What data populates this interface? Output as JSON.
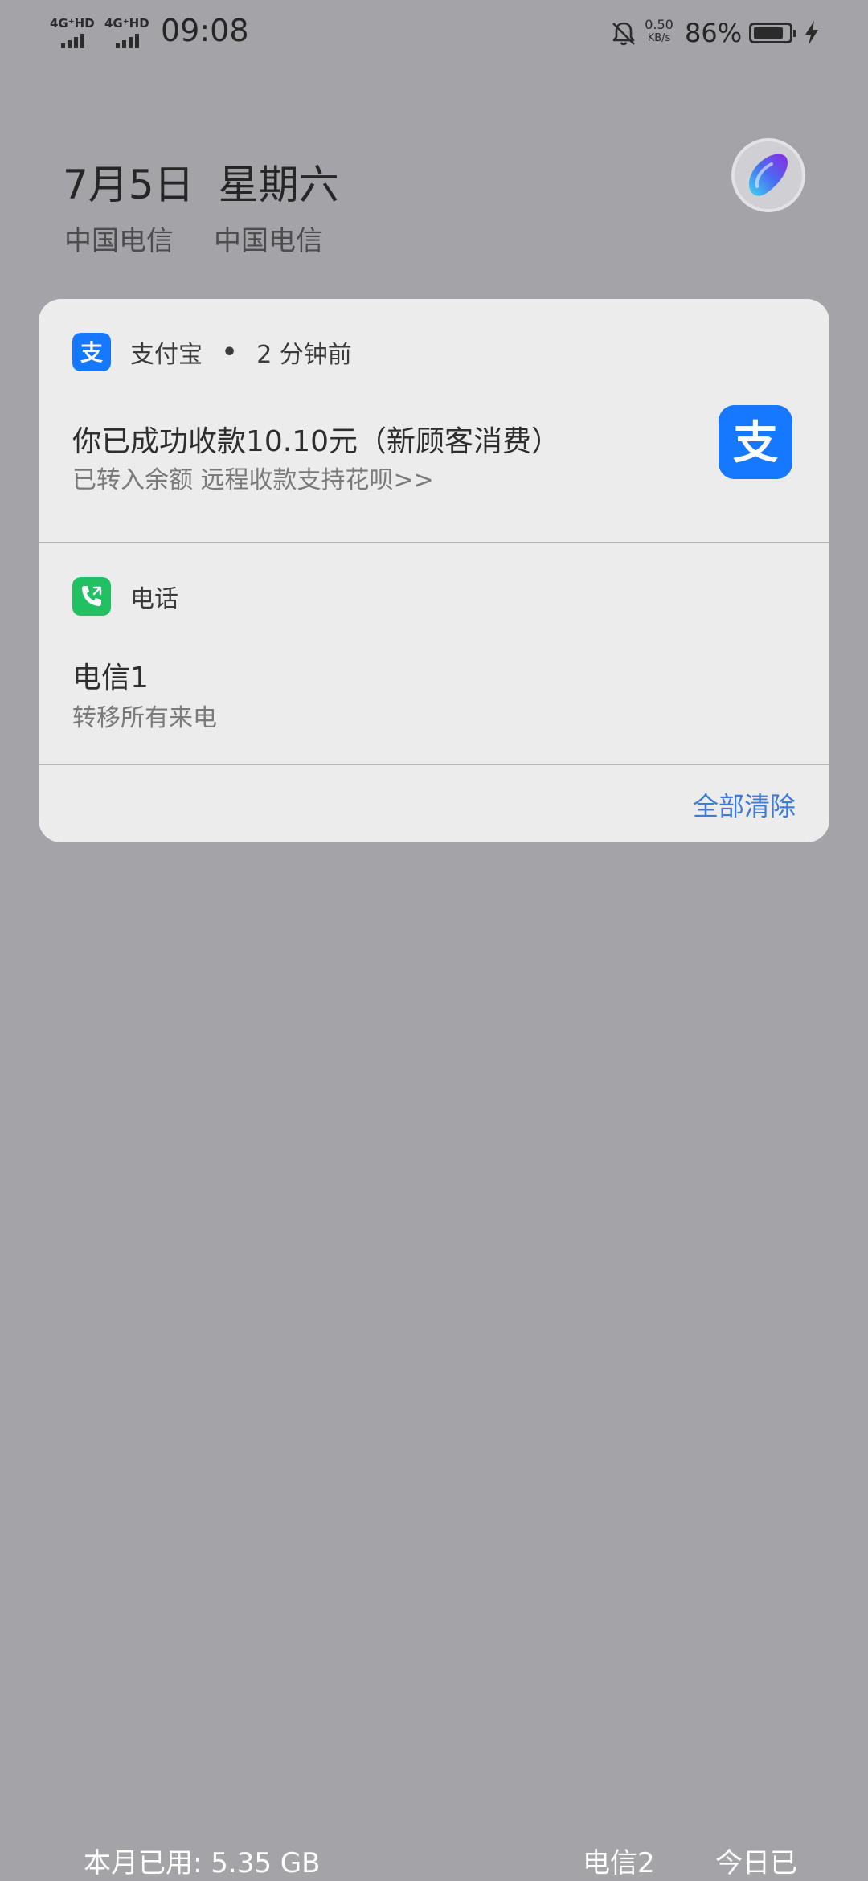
{
  "status_bar": {
    "sim1_network": "4G⁺HD",
    "sim2_network": "4G⁺HD",
    "time": "09:08",
    "net_speed_value": "0.50",
    "net_speed_unit": "KB/s",
    "battery_percent": "86%",
    "battery_level": 0.86,
    "icons": [
      "bell-off-icon",
      "battery-icon",
      "charging-icon"
    ]
  },
  "header": {
    "date": "7月5日",
    "weekday": "星期六",
    "carrier_1": "中国电信",
    "carrier_2": "中国电信",
    "assistant_icon": "assistant-orb-icon"
  },
  "notifications": [
    {
      "app": "支付宝",
      "dot": "•",
      "time": "2  分钟前",
      "title": "你已成功收款10.10元（新顾客消费）",
      "body": "已转入余额  远程收款支持花呗>>",
      "icon": "alipay-icon",
      "accent": "#1677ff"
    },
    {
      "app": "电话",
      "title": "电信1",
      "body": "转移所有来电",
      "icon": "phone-icon",
      "accent": "#21c063"
    }
  ],
  "actions": {
    "clear_all": "全部清除"
  },
  "bottom_bar": {
    "data_usage": "本月已用:  5.35  GB",
    "carrier_label": "电信2",
    "today_label": "今日已"
  },
  "colors": {
    "background": "#a3a3a8",
    "card": "#ececec",
    "link": "#3d7bd9"
  }
}
